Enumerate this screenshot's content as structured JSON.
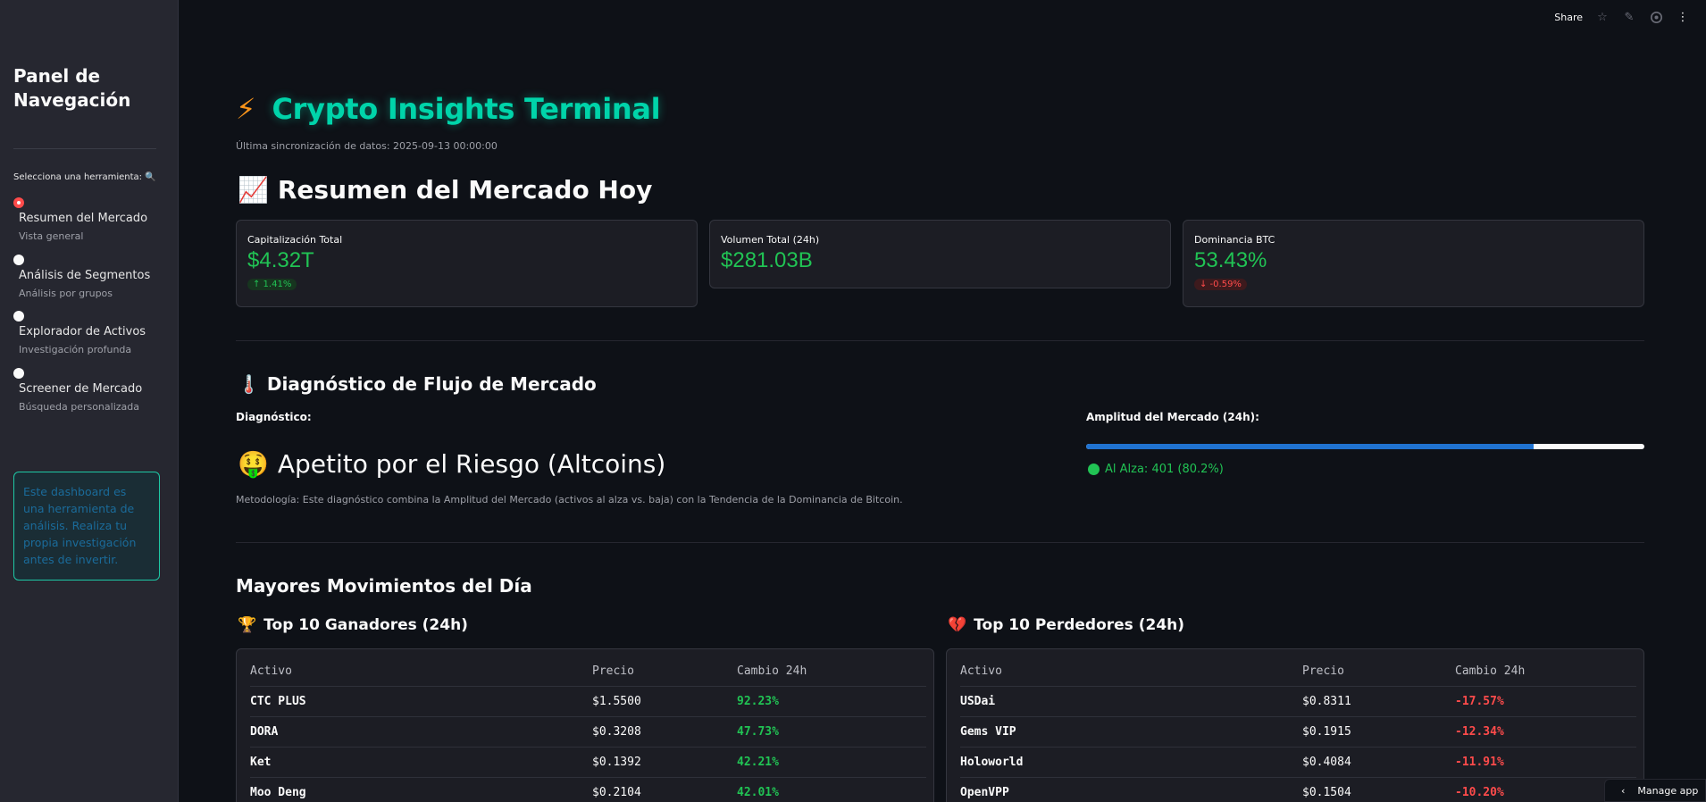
{
  "toolbar": {
    "share_label": "Share"
  },
  "sidebar": {
    "title": "Panel de Navegación",
    "select_label": "Selecciona una herramienta: 🔍",
    "items": [
      {
        "label": "Resumen del Mercado",
        "sub": "Vista general",
        "selected": true
      },
      {
        "label": "Análisis de Segmentos",
        "sub": "Análisis por grupos",
        "selected": false
      },
      {
        "label": "Explorador de Activos",
        "sub": "Investigación profunda",
        "selected": false
      },
      {
        "label": "Screener de Mercado",
        "sub": "Búsqueda personalizada",
        "selected": false
      }
    ],
    "info": "Este dashboard es una herramienta de análisis. Realiza tu propia investigación antes de invertir."
  },
  "header": {
    "icon": "⚡",
    "title": "Crypto Insights Terminal",
    "sync": "Última sincronización de datos: 2025-09-13 00:00:00"
  },
  "summary": {
    "icon": "📈",
    "title": "Resumen del Mercado Hoy",
    "metrics": [
      {
        "label": "Capitalización Total",
        "value": "$4.32T",
        "delta": "↑ 1.41%",
        "direction": "up"
      },
      {
        "label": "Volumen Total (24h)",
        "value": "$281.03B",
        "delta": "",
        "direction": "none"
      },
      {
        "label": "Dominancia BTC",
        "value": "53.43%",
        "delta": "↓ -0.59%",
        "direction": "down"
      }
    ]
  },
  "flow": {
    "icon": "🌡️",
    "title": "Diagnóstico de Flujo de Mercado",
    "diag_label": "Diagnóstico:",
    "diag_icon": "🤑",
    "diag_value": "Apetito por el Riesgo (Altcoins)",
    "methodology": "Metodología: Este diagnóstico combina la Amplitud del Mercado (activos al alza vs. baja) con la Tendencia de la Dominancia de Bitcoin.",
    "breadth_label": "Amplitud del Mercado (24h):",
    "breadth_fraction": 0.802,
    "breadth_text": "Al Alza: 401 (80.2%)"
  },
  "movers": {
    "title": "Mayores Movimientos del Día",
    "gainers_icon": "🏆",
    "gainers_title": "Top 10 Ganadores (24h)",
    "losers_icon": "💔",
    "losers_title": "Top 10 Perdedores (24h)",
    "columns": [
      "Activo",
      "Precio",
      "Cambio 24h"
    ],
    "gainers": [
      [
        "CTC PLUS",
        "$1.5500",
        "92.23%"
      ],
      [
        "DORA",
        "$0.3208",
        "47.73%"
      ],
      [
        "Ket",
        "$0.1392",
        "42.21%"
      ],
      [
        "Moo Deng",
        "$0.2104",
        "42.01%"
      ]
    ],
    "losers": [
      [
        "USDai",
        "$0.8311",
        "-17.57%"
      ],
      [
        "Gems VIP",
        "$0.1915",
        "-12.34%"
      ],
      [
        "Holoworld",
        "$0.4084",
        "-11.91%"
      ],
      [
        "OpenVPP",
        "$0.1504",
        "-10.20%"
      ]
    ]
  },
  "manage_app": "Manage app",
  "colors": {
    "accent": "#00d4aa",
    "positive": "#21c354",
    "negative": "#ff4b4b",
    "progress": "#2073d1",
    "radio_selected": "#ff4b4b"
  }
}
